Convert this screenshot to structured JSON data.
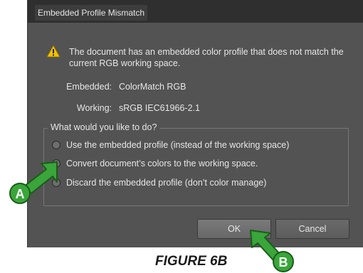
{
  "dialog": {
    "title": "Embedded Profile Mismatch",
    "message": "The document has an embedded color profile that does not match the current RGB working space.",
    "embedded_label": "Embedded:",
    "embedded_value": "ColorMatch RGB",
    "working_label": "Working:",
    "working_value": "sRGB IEC61966-2.1",
    "group_label": "What would you like to do?",
    "options": [
      {
        "label": "Use the embedded profile (instead of the working space)",
        "selected": false
      },
      {
        "label": "Convert document’s colors to the working space.",
        "selected": true
      },
      {
        "label": "Discard the embedded profile (don’t color manage)",
        "selected": false
      }
    ],
    "ok_label": "OK",
    "cancel_label": "Cancel"
  },
  "annotations": {
    "marker_a": "A",
    "marker_b": "B",
    "caption": "FIGURE 6B",
    "arrow_color": "#3aa53a",
    "arrow_outline": "#1a5c1a"
  },
  "colors": {
    "dialog_bg": "#535353",
    "titlebar_bg": "#2f2f2f",
    "warning_yellow": "#f2c200"
  }
}
